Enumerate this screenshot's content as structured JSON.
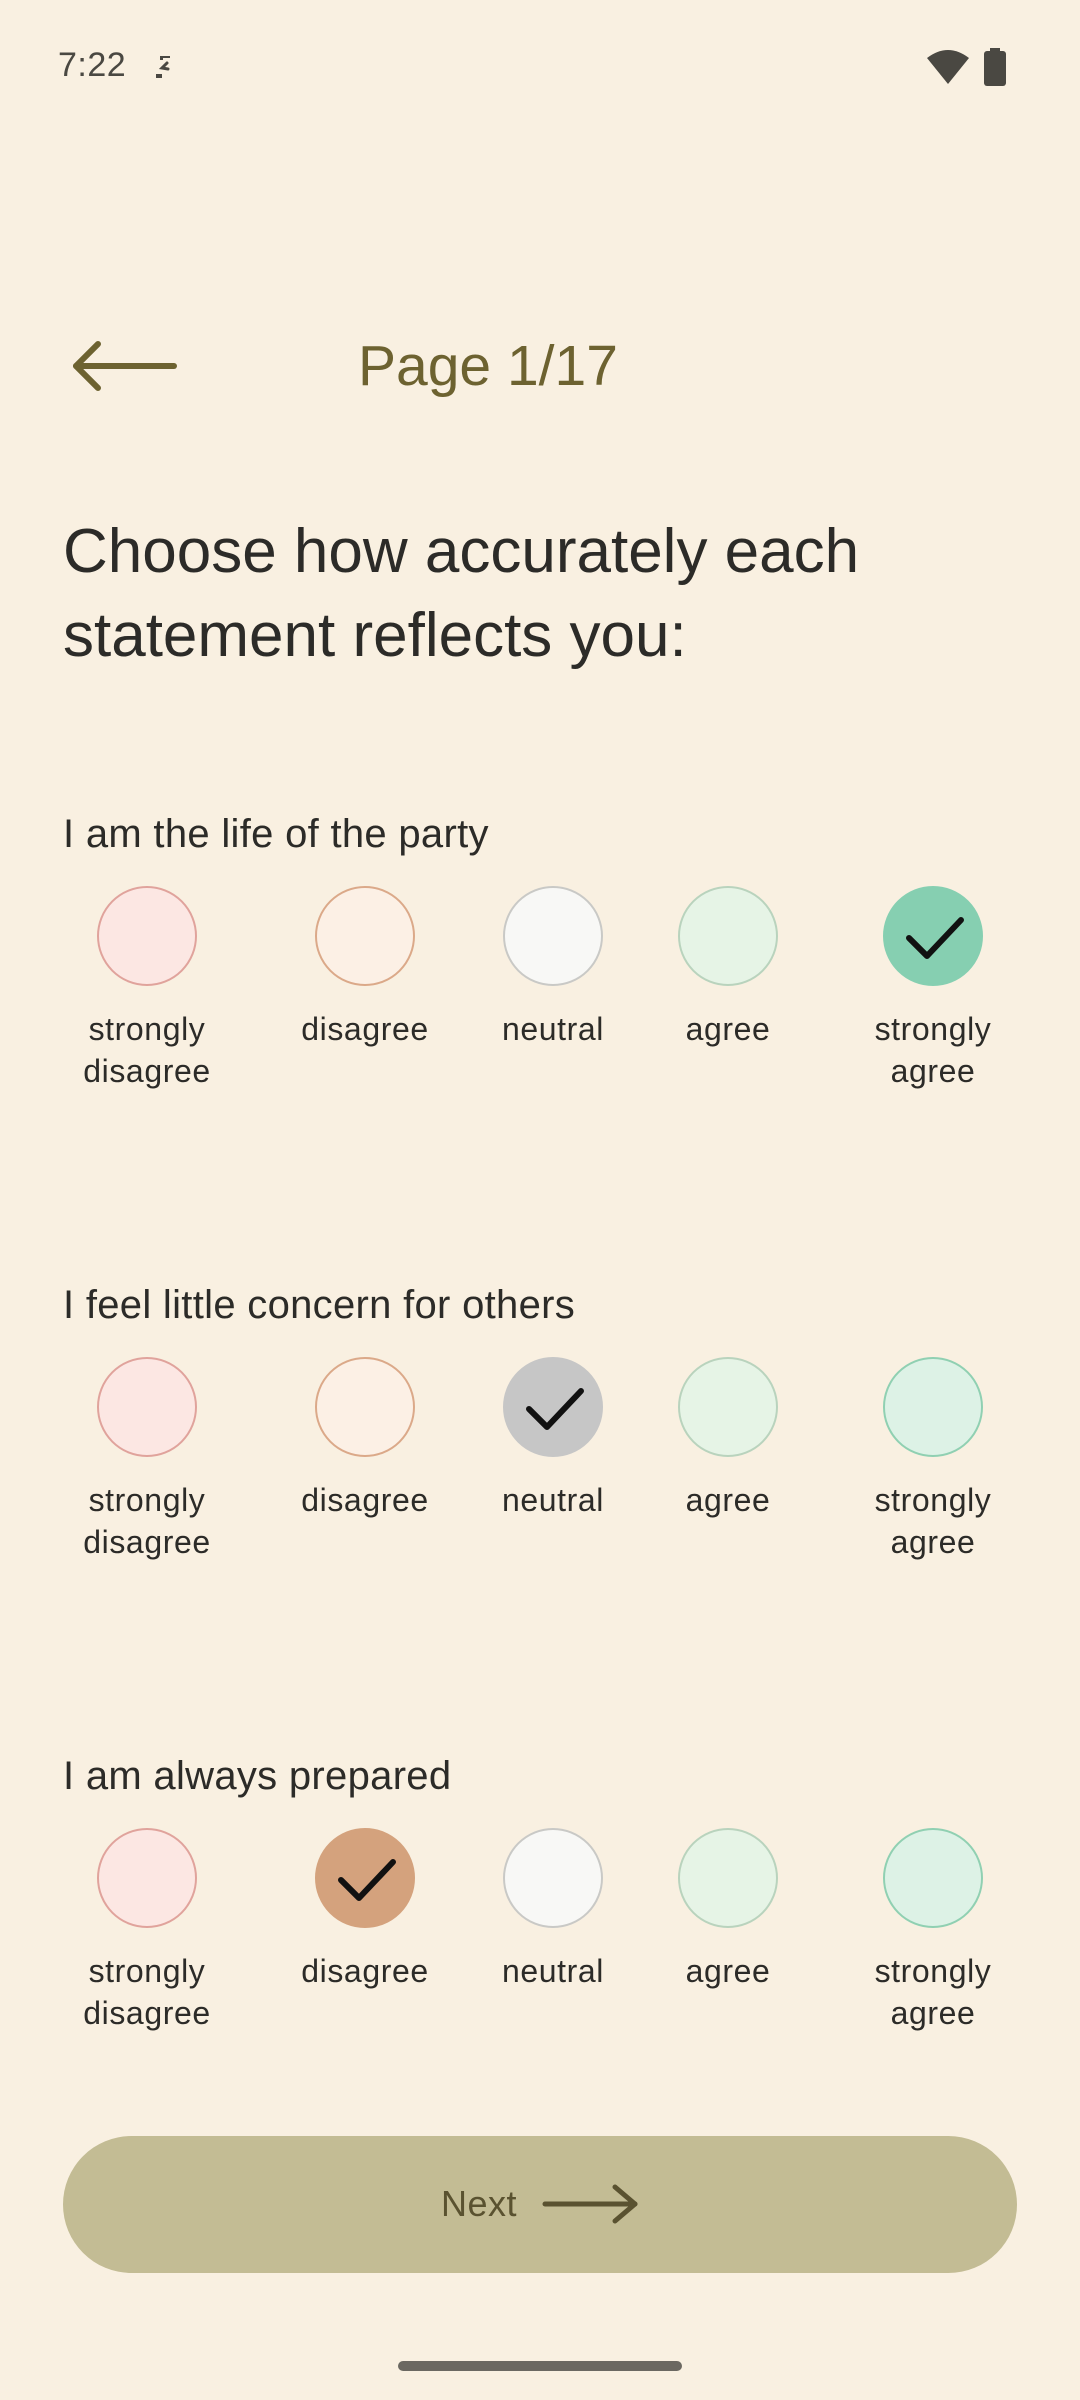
{
  "status_bar": {
    "time": "7:22",
    "rotate_icon": "screen-rotate-icon",
    "wifi_icon": "wifi-icon",
    "battery_icon": "battery-icon"
  },
  "header": {
    "back_icon": "arrow-left-icon",
    "page_label": "Page 1/17"
  },
  "instructions": "Choose how accurately each statement reflects you:",
  "questions": [
    {
      "text": "I am the life of the party",
      "selected": "strongly agree",
      "options": [
        {
          "label_line1": "strongly",
          "label_line2": "disagree"
        },
        {
          "label_line1": "disagree",
          "label_line2": ""
        },
        {
          "label_line1": "neutral",
          "label_line2": ""
        },
        {
          "label_line1": "agree",
          "label_line2": ""
        },
        {
          "label_line1": "strongly",
          "label_line2": "agree"
        }
      ]
    },
    {
      "text": "I feel little concern for others",
      "selected": "neutral",
      "options": [
        {
          "label_line1": "strongly",
          "label_line2": "disagree"
        },
        {
          "label_line1": "disagree",
          "label_line2": ""
        },
        {
          "label_line1": "neutral",
          "label_line2": ""
        },
        {
          "label_line1": "agree",
          "label_line2": ""
        },
        {
          "label_line1": "strongly",
          "label_line2": "agree"
        }
      ]
    },
    {
      "text": "I am always prepared",
      "selected": "disagree",
      "options": [
        {
          "label_line1": "strongly",
          "label_line2": "disagree"
        },
        {
          "label_line1": "disagree",
          "label_line2": ""
        },
        {
          "label_line1": "neutral",
          "label_line2": ""
        },
        {
          "label_line1": "agree",
          "label_line2": ""
        },
        {
          "label_line1": "strongly",
          "label_line2": "agree"
        }
      ]
    }
  ],
  "next_button": {
    "label": "Next",
    "icon": "arrow-right-icon"
  },
  "colors": {
    "background": "#F9F0E1",
    "accent_text": "#6D6230",
    "next_button": "#C3BC94",
    "selected_strongly_agree": "#86CFB1",
    "selected_neutral": "#C6C6C6",
    "selected_disagree": "#D4A27D"
  }
}
